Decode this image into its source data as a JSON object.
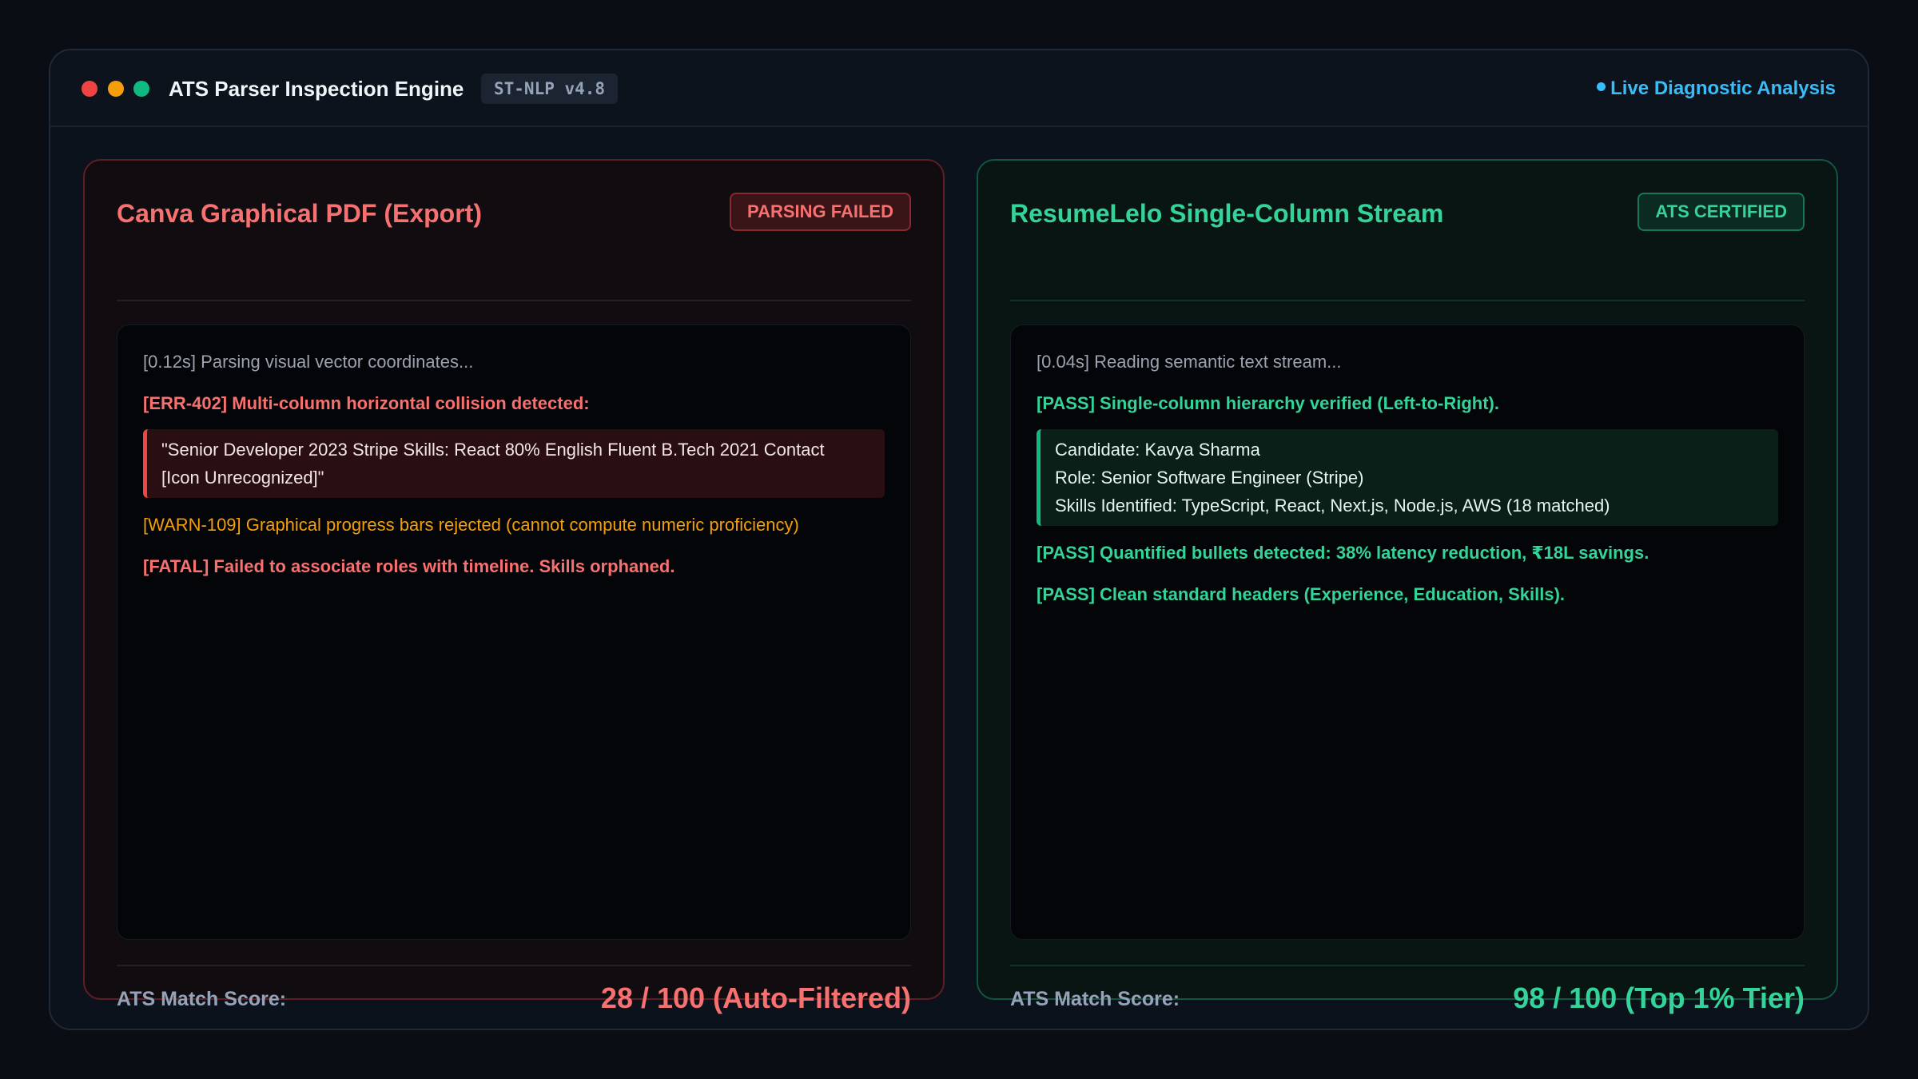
{
  "window": {
    "title": "ATS Parser Inspection Engine",
    "version": "ST-NLP v4.8",
    "live_status": "Live Diagnostic Analysis"
  },
  "left_panel": {
    "title": "Canva Graphical PDF (Export)",
    "status": "PARSING FAILED",
    "log": [
      "[0.12s] Parsing visual vector coordinates...",
      "[ERR-402] Multi-column horizontal collision detected:",
      "[WARN-109] Graphical progress bars rejected (cannot compute numeric proficiency)",
      "[FATAL] Failed to associate roles with timeline. Skills orphaned."
    ],
    "quote_lines": [
      "\"Senior Developer 2023 Stripe Skills: React 80% English Fluent B.Tech 2021 Contact",
      "[Icon Unrecognized]\""
    ],
    "score_label": "ATS Match Score:",
    "score_value": "28 / 100 (Auto-Filtered)"
  },
  "right_panel": {
    "title": "ResumeLelo Single-Column Stream",
    "status": "ATS CERTIFIED",
    "log": [
      "[0.04s] Reading semantic text stream...",
      "[PASS] Single-column hierarchy verified (Left-to-Right).",
      "[PASS] Quantified bullets detected: 38% latency reduction, ₹18L savings.",
      "[PASS] Clean standard headers (Experience, Education, Skills)."
    ],
    "extracted": [
      "Candidate: Kavya Sharma",
      "Role: Senior Software Engineer (Stripe)",
      "Skills Identified: TypeScript, React, Next.js, Node.js, AWS (18 matched)"
    ],
    "score_label": "ATS Match Score:",
    "score_value": "98 / 100 (Top 1% Tier)"
  },
  "colors": {
    "fail_accent": "#f87171",
    "pass_accent": "#34d399",
    "warn": "#f59e0b",
    "live": "#38bdf8"
  }
}
